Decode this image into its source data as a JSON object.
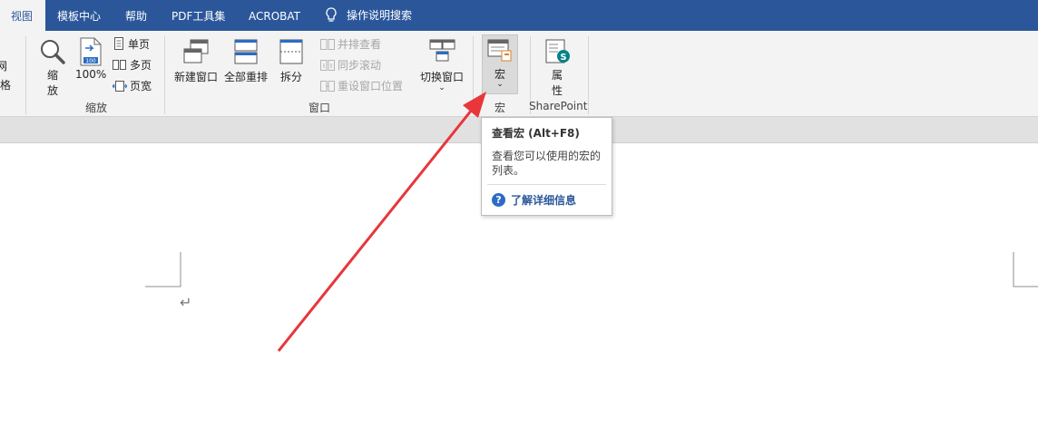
{
  "tabs": [
    {
      "label": "视图",
      "active": true
    },
    {
      "label": "模板中心"
    },
    {
      "label": "帮助"
    },
    {
      "label": "PDF工具集"
    },
    {
      "label": "ACROBAT"
    },
    {
      "label": "操作说明搜索"
    }
  ],
  "ribbon": {
    "left_partial": {
      "line1": "网",
      "line2": "格"
    },
    "zoom": {
      "zoom_label_1": "缩",
      "zoom_label_2": "放",
      "percent_label": "100%",
      "single_page": "单页",
      "multi_page": "多页",
      "page_width": "页宽",
      "group_label": "缩放"
    },
    "window": {
      "new_window": "新建窗口",
      "arrange_all": "全部重排",
      "split": "拆分",
      "side_by_side": "并排查看",
      "sync_scroll": "同步滚动",
      "reset_position": "重设窗口位置",
      "switch_window": "切换窗口",
      "group_label": "窗口"
    },
    "macro": {
      "label": "宏",
      "group_label": "宏"
    },
    "sharepoint": {
      "label_1": "属",
      "label_2": "性",
      "group_label": "SharePoint"
    }
  },
  "tooltip": {
    "title": "查看宏 (Alt+F8)",
    "description": "查看您可以使用的宏的列表。",
    "link": "了解详细信息"
  },
  "document": {
    "paragraph_mark": "↵"
  },
  "colors": {
    "ribbon_blue": "#2b579a",
    "arrow_red": "#e8363b"
  }
}
